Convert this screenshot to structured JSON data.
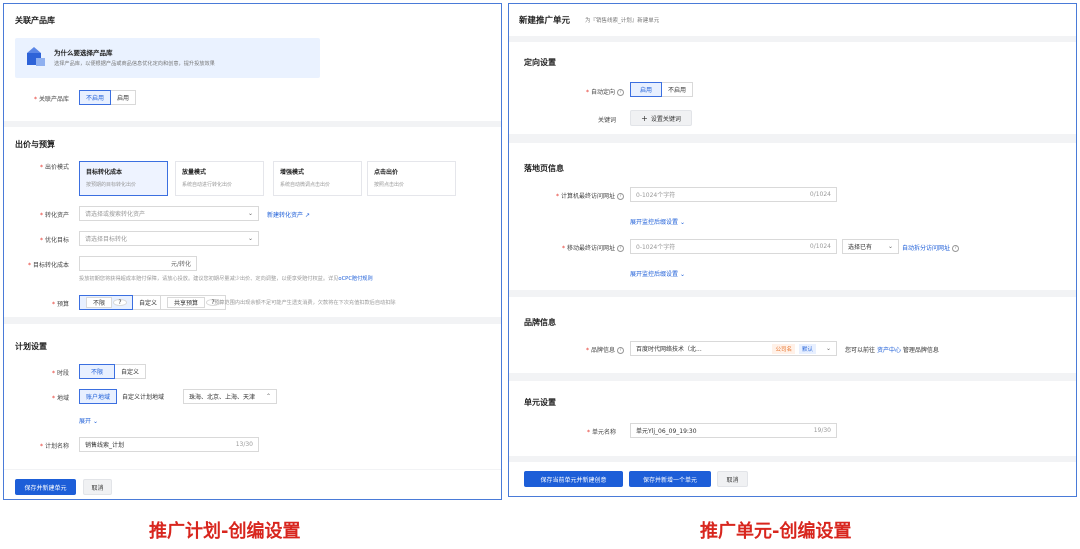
{
  "left_panel": {
    "product_lib": {
      "title": "关联产品库",
      "banner_title": "为什么要选择产品库",
      "banner_desc": "选择产品库，以便根据产品或商品信息优化定向和创意，提升投放效果",
      "field_label": "关联产品库",
      "options": [
        "不启用",
        "启用"
      ],
      "selected": "不启用"
    },
    "bidding": {
      "title": "出价与预算",
      "mode_label": "出价模式",
      "modes": [
        {
          "title": "目标转化成本",
          "desc": "按预期的目标转化出价"
        },
        {
          "title": "放量模式",
          "desc": "系统自动进行转化出价"
        },
        {
          "title": "增强模式",
          "desc": "系统自动微调点击出价"
        },
        {
          "title": "点击出价",
          "desc": "按照点击出价"
        }
      ],
      "asset_label": "转化资产",
      "asset_placeholder": "请选择或搜索转化资产",
      "asset_link": "新建转化资产",
      "goal_label": "优化目标",
      "goal_placeholder": "请选择目标转化",
      "cost_label": "目标转化成本",
      "cost_unit": "元/转化",
      "cost_hint": "投放初期您将获得超成本赔付保障，请放心投放。建议您初期尽量减少出价、定向调整，以便享受赔付权益。详见",
      "cost_hint_link": "oCPC赔付规则",
      "budget_label": "预算",
      "budget_options": [
        "不限",
        "自定义",
        "共享预算"
      ],
      "budget_hint": "预算范围内出现余额不足可能产生透支消费，欠款将在下次充值扣款后自动扣除"
    },
    "plan": {
      "title": "计划设置",
      "period_label": "时段",
      "period_options": [
        "不限",
        "自定义"
      ],
      "region_label": "地域",
      "region_options": [
        "账户地域",
        "自定义计划地域"
      ],
      "region_value": "珠海、北京、上海、天津",
      "expand": "展开",
      "name_label": "计划名称",
      "name_value": "销售线索_计划",
      "name_count": "13/30"
    },
    "buttons": {
      "save": "保存并新建单元",
      "cancel": "取消"
    }
  },
  "right_panel": {
    "header_title": "新建推广单元",
    "header_sub": "为『销售线索_计划』新建单元",
    "targeting": {
      "title": "定向设置",
      "auto_label": "自动定向",
      "auto_options": [
        "启用",
        "不启用"
      ],
      "keyword_label": "关键词",
      "keyword_button": "设置关键词"
    },
    "landing": {
      "title": "落地页信息",
      "pc_label": "计算机最终访问网址",
      "pc_placeholder": "0-1024个字符",
      "pc_count": "0/1024",
      "expand1": "展开监控后缀设置",
      "mobile_label": "移动最终访问网址",
      "mobile_placeholder": "0-1024个字符",
      "mobile_count": "0/1024",
      "select_existing": "选择已有",
      "auto_split": "自动拆分访问网址",
      "expand2": "展开监控后缀设置"
    },
    "brand": {
      "title": "品牌信息",
      "label": "品牌信息",
      "value": "百度时代网络技术（北...",
      "tag_company": "公司名",
      "tag_default": "默认",
      "note_prefix": "您可以前往",
      "note_link": "资产中心",
      "note_suffix": "管理品牌信息"
    },
    "unit": {
      "title": "单元设置",
      "name_label": "单元名称",
      "name_value": "单元Ylj_06_09_19:30",
      "name_count": "19/30"
    },
    "buttons": {
      "save_creative": "保存当前单元并新建创意",
      "save_new": "保存并新增一个单元",
      "cancel": "取消"
    }
  },
  "captions": {
    "left": "推广计划-创编设置",
    "right": "推广单元-创编设置"
  },
  "colors": {
    "primary": "#1d5ed8",
    "caption": "#d8261e",
    "frame": "#4a7bd8"
  }
}
